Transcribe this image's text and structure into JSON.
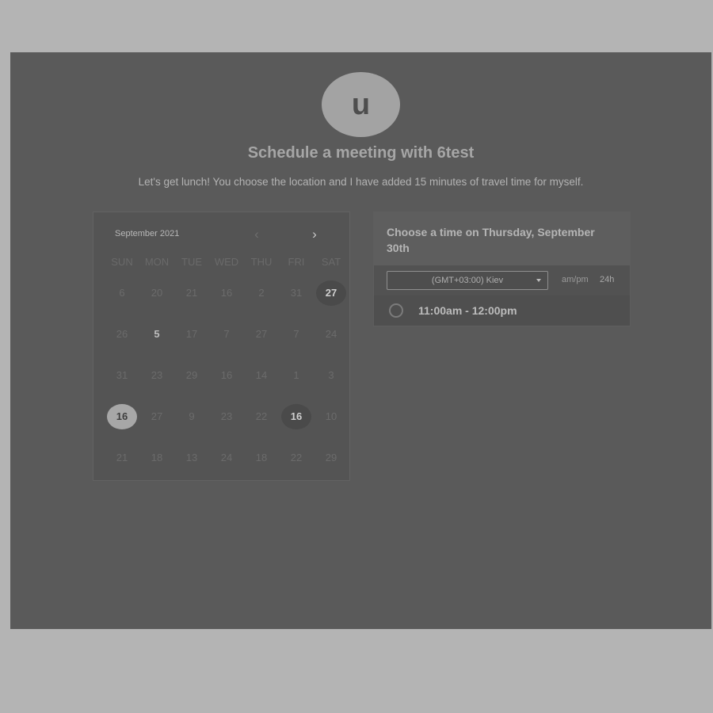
{
  "host": {
    "avatar_letter": "u",
    "title": "Schedule a meeting with 6test",
    "description": "Let's get lunch! You choose the location and I have added 15 minutes of travel time for myself."
  },
  "calendar": {
    "month_label": "September 2021",
    "prev_icon": "‹",
    "next_icon": "›",
    "weekdays": [
      "SUN",
      "MON",
      "TUE",
      "WED",
      "THU",
      "FRI",
      "SAT"
    ],
    "weeks": [
      [
        {
          "d": "6"
        },
        {
          "d": "20"
        },
        {
          "d": "21"
        },
        {
          "d": "16"
        },
        {
          "d": "2"
        },
        {
          "d": "31"
        },
        {
          "d": "27",
          "state": "selected-dark"
        }
      ],
      [
        {
          "d": "26"
        },
        {
          "d": "5",
          "state": "available"
        },
        {
          "d": "17"
        },
        {
          "d": "7"
        },
        {
          "d": "27"
        },
        {
          "d": "7"
        },
        {
          "d": "24"
        }
      ],
      [
        {
          "d": "31"
        },
        {
          "d": "23"
        },
        {
          "d": "29"
        },
        {
          "d": "16"
        },
        {
          "d": "14"
        },
        {
          "d": "1"
        },
        {
          "d": "3"
        }
      ],
      [
        {
          "d": "16",
          "state": "selected-light"
        },
        {
          "d": "27"
        },
        {
          "d": "9"
        },
        {
          "d": "23"
        },
        {
          "d": "22"
        },
        {
          "d": "16",
          "state": "selected-dark"
        },
        {
          "d": "10"
        }
      ],
      [
        {
          "d": "21"
        },
        {
          "d": "18"
        },
        {
          "d": "13"
        },
        {
          "d": "24"
        },
        {
          "d": "18"
        },
        {
          "d": "22"
        },
        {
          "d": "29"
        }
      ]
    ]
  },
  "time_panel": {
    "heading": "Choose a time on Thursday, September 30th",
    "timezone": "(GMT+03:00) Kiev",
    "format_ampm": "am/pm",
    "format_24h": "24h",
    "slots": [
      {
        "label": "11:00am - 12:00pm"
      }
    ]
  }
}
